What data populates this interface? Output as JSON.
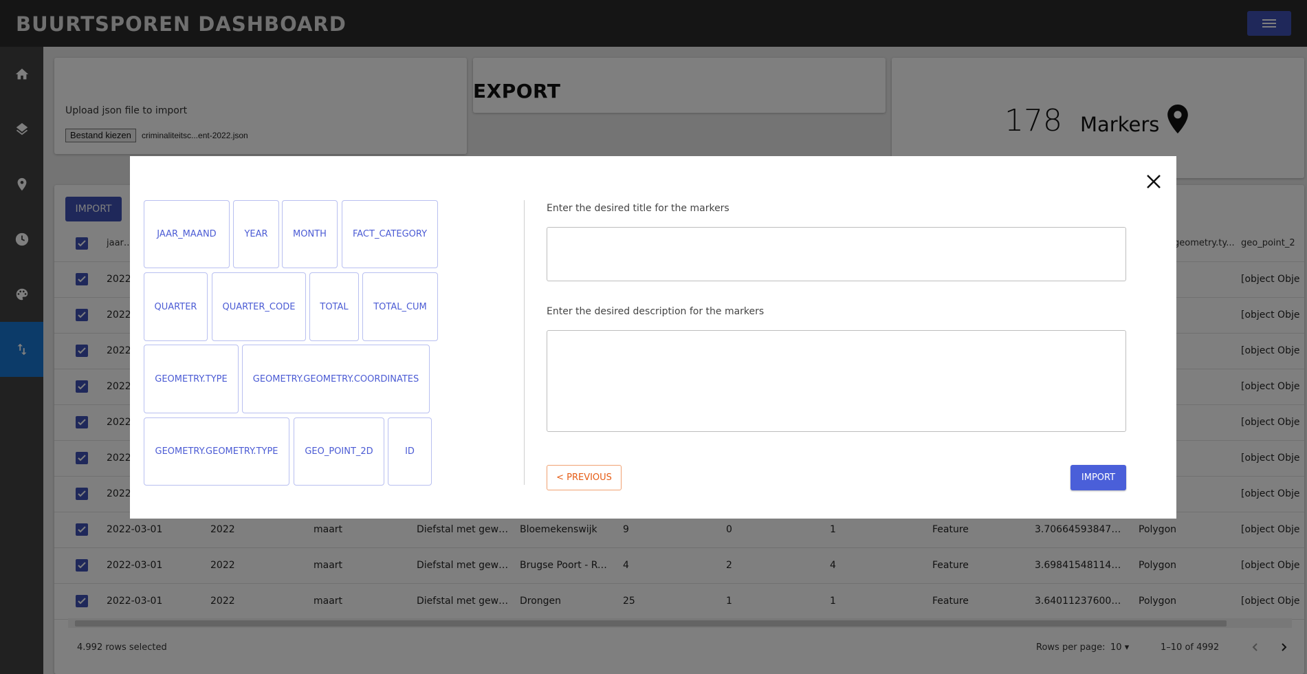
{
  "header": {
    "title": "BUURTSPOREN DASHBOARD",
    "menu_icon": "hamburger-menu-icon",
    "accent": "#3f51b5"
  },
  "sidebar": {
    "items": [
      {
        "icon": "home-icon"
      },
      {
        "icon": "layers-icon"
      },
      {
        "icon": "location-pin-icon"
      },
      {
        "icon": "clock-icon"
      },
      {
        "icon": "palette-icon"
      },
      {
        "icon": "import-export-icon",
        "active": true
      }
    ]
  },
  "upload": {
    "label": "Upload json file to import",
    "button": "Bestand kiezen",
    "file_name": "criminaliteitsc...ent-2022.json"
  },
  "export": {
    "title": "EXPORT"
  },
  "markers": {
    "count": "178",
    "label": "Markers"
  },
  "table": {
    "import_label": "IMPORT",
    "header": {
      "c1": "jaar_m",
      "c11": "geometry.ty...",
      "c12": "geo_point_2"
    },
    "partial_rows": [
      {
        "c1": "2022",
        "c12": "[object Obje"
      },
      {
        "c1": "2022",
        "c12": "[object Obje"
      },
      {
        "c1": "2022",
        "c12": "[object Obje"
      },
      {
        "c1": "2022",
        "c12": "[object Obje"
      },
      {
        "c1": "2022",
        "c12": "[object Obje"
      },
      {
        "c1": "2022",
        "c12": "[object Obje"
      },
      {
        "c1": "2022",
        "c12": "[object Obje"
      }
    ],
    "rows": [
      {
        "c1": "2022-03-01",
        "c2": "2022",
        "c3": "maart",
        "c4": "Diefstal met geweld ...",
        "c5": "Bloemekenswijk",
        "c6": "9",
        "c7": "0",
        "c8": "1",
        "c9": "Feature",
        "c10": "3.706645938470...",
        "c11": "Polygon",
        "c12": "[object Obje"
      },
      {
        "c1": "2022-03-01",
        "c2": "2022",
        "c3": "maart",
        "c4": "Diefstal met geweld ...",
        "c5": "Brugse Poort - Rooi...",
        "c6": "4",
        "c7": "2",
        "c8": "4",
        "c9": "Feature",
        "c10": "3.698415481148...",
        "c11": "Polygon",
        "c12": "[object Obje"
      },
      {
        "c1": "2022-03-01",
        "c2": "2022",
        "c3": "maart",
        "c4": "Diefstal met geweld ...",
        "c5": "Drongen",
        "c6": "25",
        "c7": "1",
        "c8": "1",
        "c9": "Feature",
        "c10": "3.640112376002...",
        "c11": "Polygon",
        "c12": "[object Obje"
      }
    ],
    "footer": {
      "selected": "4.992 rows selected",
      "rows_per_page_label": "Rows per page:",
      "rows_per_page": "10",
      "range": "1–10 of 4992"
    }
  },
  "modal": {
    "chips": [
      "JAAR_MAAND",
      "YEAR",
      "MONTH",
      "FACT_CATEGORY",
      "QUARTER",
      "QUARTER_CODE",
      "TOTAL",
      "TOTAL_CUM",
      "GEOMETRY.TYPE",
      "GEOMETRY.GEOMETRY.COORDINATES",
      "GEOMETRY.GEOMETRY.TYPE",
      "GEO_POINT_2D",
      "ID"
    ],
    "title_label": "Enter the desired title for the markers",
    "title_value": "",
    "description_label": "Enter the desired description for the markers",
    "description_value": "",
    "previous_label": "< PREVIOUS",
    "import_label": "IMPORT",
    "close_icon": "close-icon"
  }
}
